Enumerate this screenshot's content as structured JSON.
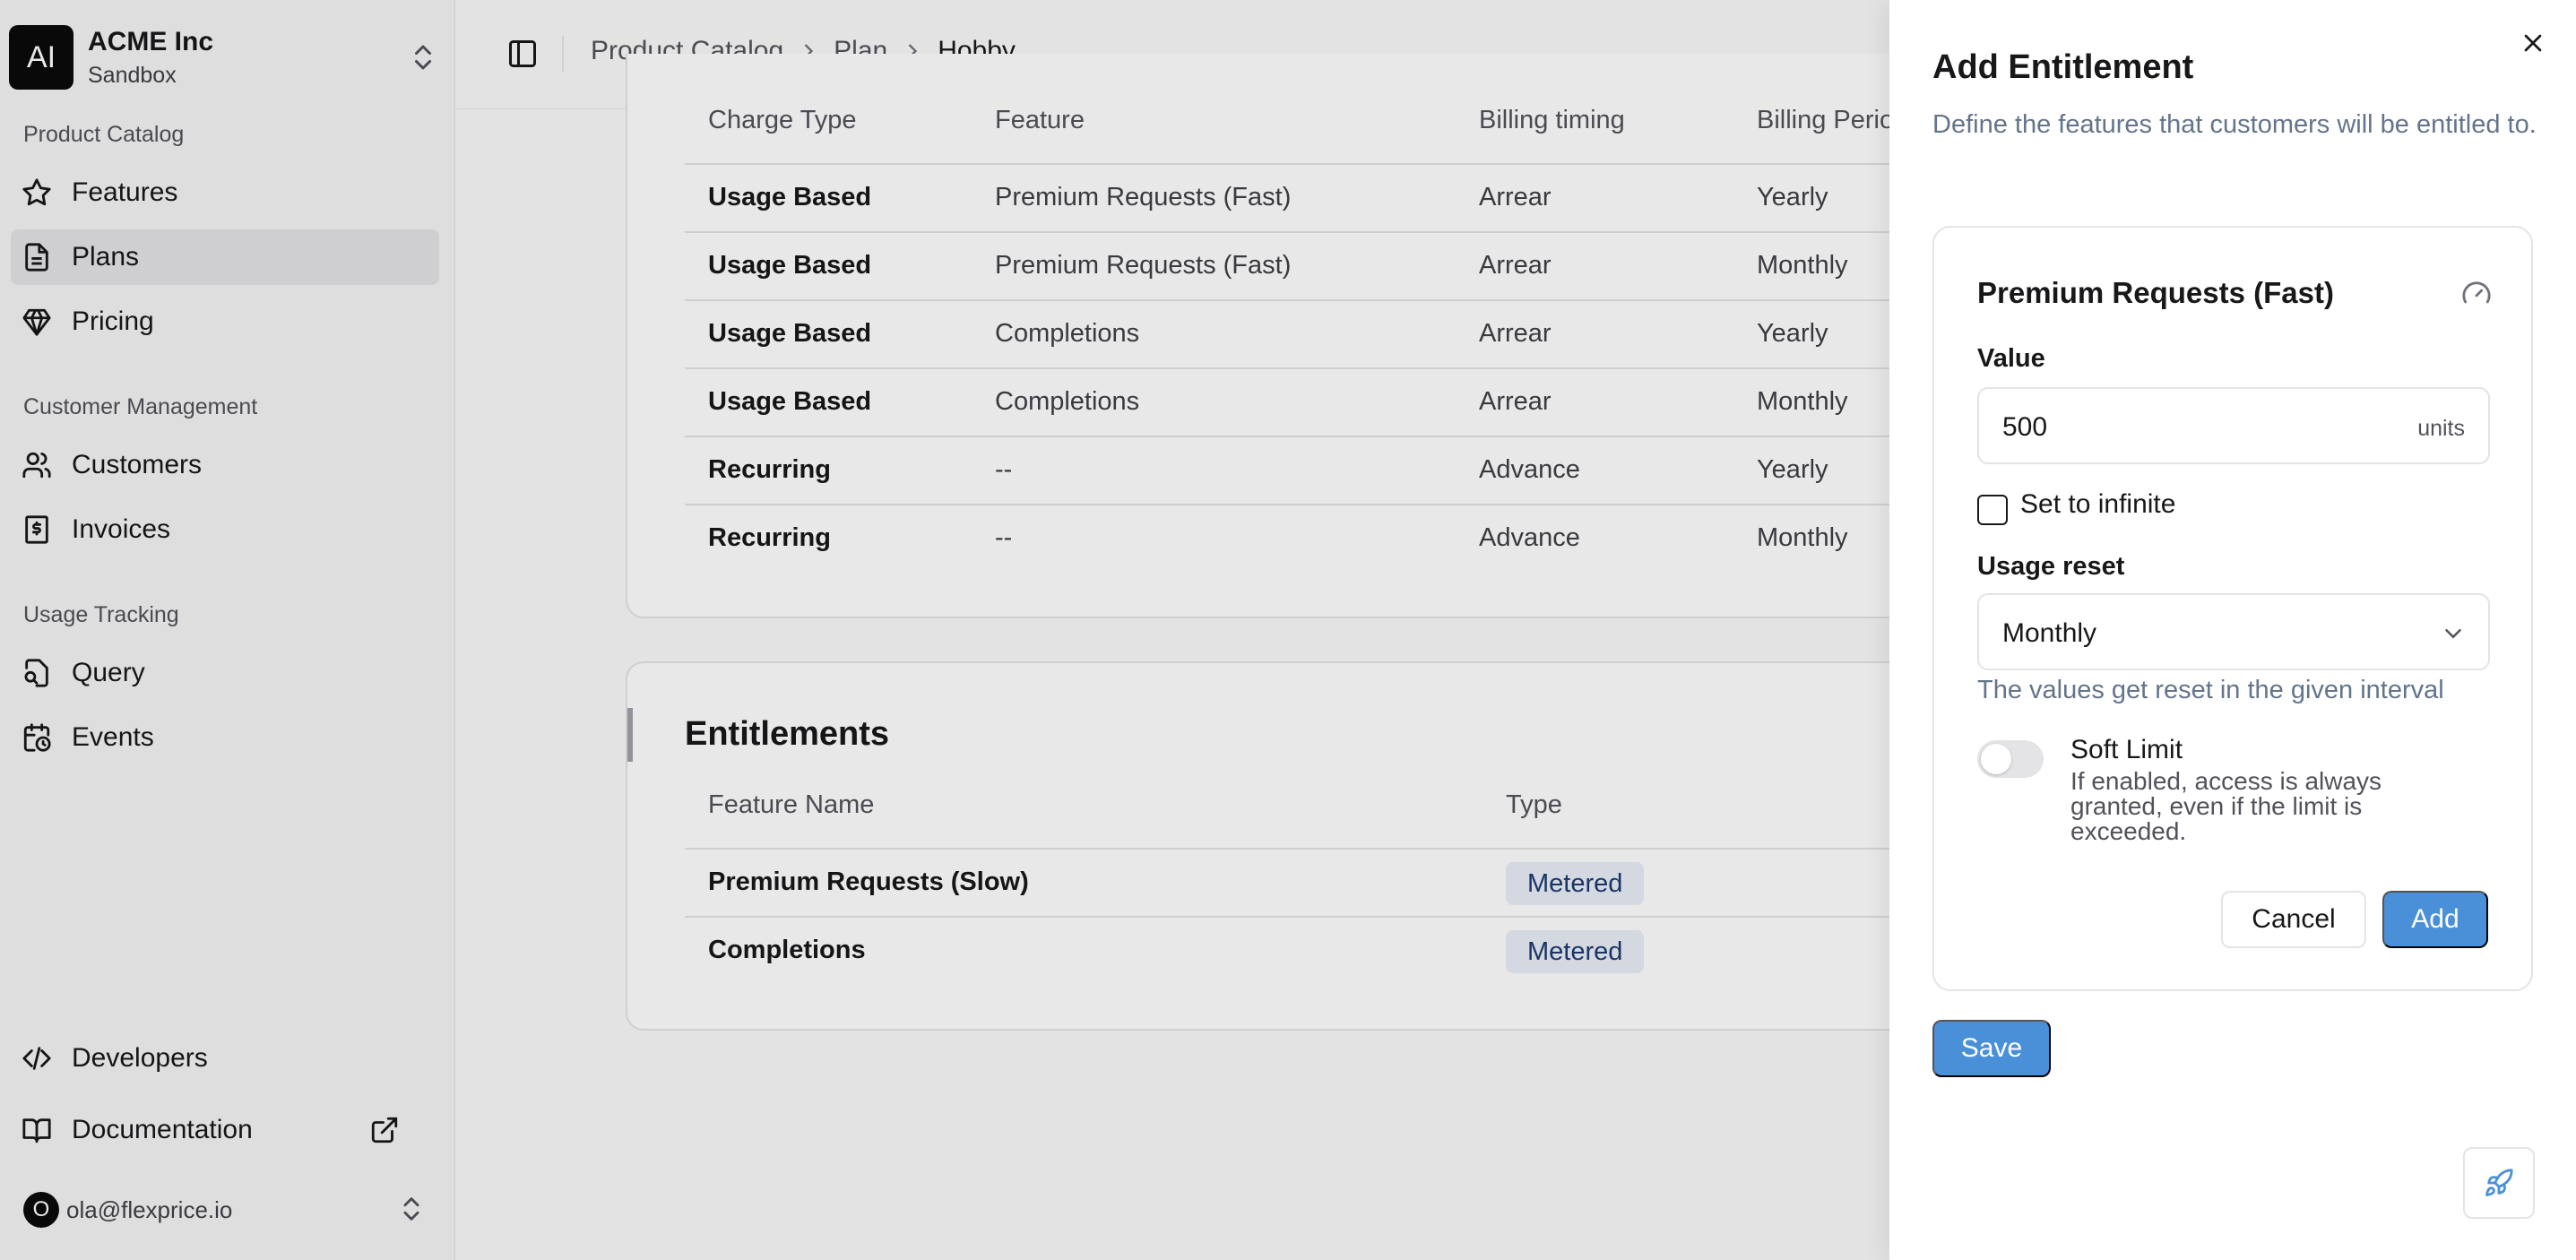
{
  "org": {
    "logo_text": "AI",
    "name": "ACME Inc",
    "environment": "Sandbox"
  },
  "sidebar": {
    "sections": [
      {
        "label": "Product Catalog",
        "items": [
          {
            "label": "Features",
            "icon": "star-icon"
          },
          {
            "label": "Plans",
            "icon": "document-icon",
            "active": true
          },
          {
            "label": "Pricing",
            "icon": "gem-icon"
          }
        ]
      },
      {
        "label": "Customer Management",
        "items": [
          {
            "label": "Customers",
            "icon": "users-icon"
          },
          {
            "label": "Invoices",
            "icon": "receipt-icon"
          }
        ]
      },
      {
        "label": "Usage Tracking",
        "items": [
          {
            "label": "Query",
            "icon": "search-file-icon"
          },
          {
            "label": "Events",
            "icon": "calendar-clock-icon"
          }
        ]
      }
    ],
    "footer": [
      {
        "label": "Developers",
        "icon": "code-icon"
      },
      {
        "label": "Documentation",
        "icon": "book-icon"
      }
    ],
    "user": {
      "initial": "O",
      "email": "ola@flexprice.io"
    }
  },
  "breadcrumb": [
    "Product Catalog",
    "Plan",
    "Hobby"
  ],
  "charges": {
    "columns": [
      "Charge Type",
      "Feature",
      "Billing timing",
      "Billing Perio"
    ],
    "rows": [
      [
        "Usage Based",
        "Premium Requests (Fast)",
        "Arrear",
        "Yearly"
      ],
      [
        "Usage Based",
        "Premium Requests (Fast)",
        "Arrear",
        "Monthly"
      ],
      [
        "Usage Based",
        "Completions",
        "Arrear",
        "Yearly"
      ],
      [
        "Usage Based",
        "Completions",
        "Arrear",
        "Monthly"
      ],
      [
        "Recurring",
        "--",
        "Advance",
        "Yearly"
      ],
      [
        "Recurring",
        "--",
        "Advance",
        "Monthly"
      ]
    ]
  },
  "entitlements": {
    "title": "Entitlements",
    "columns": [
      "Feature Name",
      "Type"
    ],
    "rows": [
      [
        "Premium Requests (Slow)",
        "Metered"
      ],
      [
        "Completions",
        "Metered"
      ]
    ]
  },
  "drawer": {
    "title": "Add Entitlement",
    "description": "Define the features that customers will be entitled to.",
    "feature_name": "Premium Requests (Fast)",
    "value_label": "Value",
    "value": "500",
    "value_unit": "units",
    "infinite_label": "Set to infinite",
    "infinite_checked": false,
    "usage_reset_label": "Usage reset",
    "usage_reset_value": "Monthly",
    "usage_reset_hint": "The values get reset in the given interval",
    "soft_limit_title": "Soft Limit",
    "soft_limit_desc": "If enabled, access is always granted, even if the limit is exceeded.",
    "soft_limit_enabled": false,
    "cancel_label": "Cancel",
    "add_label": "Add",
    "save_label": "Save"
  },
  "colors": {
    "accent": "#4a90d9",
    "badge_bg": "#e8eef8",
    "badge_text": "#1e3a6d",
    "muted_text": "#64748b"
  }
}
